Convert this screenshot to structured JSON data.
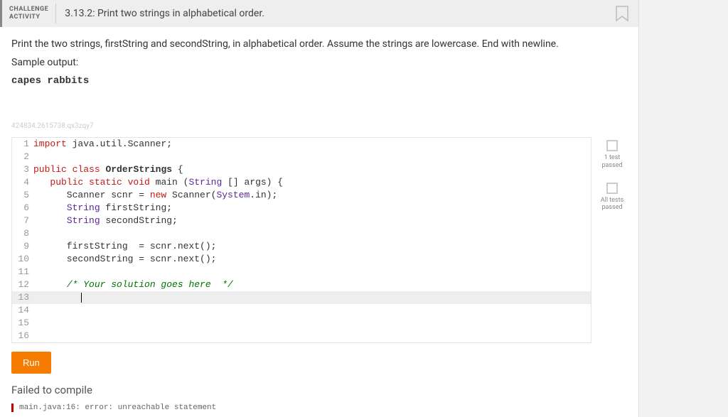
{
  "header": {
    "badge_line1": "CHALLENGE",
    "badge_line2": "ACTIVITY",
    "title": "3.13.2: Print two strings in alphabetical order."
  },
  "description": "Print the two strings, firstString and secondString, in alphabetical order. Assume the strings are lowercase. End with newline.",
  "sample_label": "Sample output:",
  "sample_output": "capes rabbits",
  "watermark": "424834.2615738.qx3zqy7",
  "code_lines": [
    {
      "n": "1",
      "hl": false,
      "html": "<span class='kw'>import</span> java.util.Scanner;"
    },
    {
      "n": "2",
      "hl": false,
      "html": ""
    },
    {
      "n": "3",
      "hl": false,
      "html": "<span class='kw'>public class</span> <span class='cls'>OrderStrings</span> {"
    },
    {
      "n": "4",
      "hl": false,
      "html": "   <span class='kw'>public static void</span> main (<span class='type'>String</span> [] args) {"
    },
    {
      "n": "5",
      "hl": false,
      "html": "      Scanner scnr = <span class='kw'>new</span> Scanner(<span class='type'>System</span>.in);"
    },
    {
      "n": "6",
      "hl": false,
      "html": "      <span class='type'>String</span> firstString;"
    },
    {
      "n": "7",
      "hl": false,
      "html": "      <span class='type'>String</span> secondString;"
    },
    {
      "n": "8",
      "hl": false,
      "html": ""
    },
    {
      "n": "9",
      "hl": false,
      "html": "      firstString  = scnr.next();"
    },
    {
      "n": "10",
      "hl": false,
      "html": "      secondString = scnr.next();"
    },
    {
      "n": "11",
      "hl": false,
      "html": ""
    },
    {
      "n": "12",
      "hl": false,
      "html": "      <span class='cmt'>/* Your solution goes here  */</span>"
    },
    {
      "n": "13",
      "hl": true,
      "html": "      <span class='cursor'></span>"
    },
    {
      "n": "14",
      "hl": false,
      "html": ""
    },
    {
      "n": "15",
      "hl": false,
      "html": ""
    },
    {
      "n": "16",
      "hl": false,
      "html": ""
    }
  ],
  "status": {
    "test1_label": "1 test passed",
    "test2_label": "All tests passed"
  },
  "run_label": "Run",
  "error_message": "Failed to compile",
  "error_detail": "main.java:16: error: unreachable statement"
}
